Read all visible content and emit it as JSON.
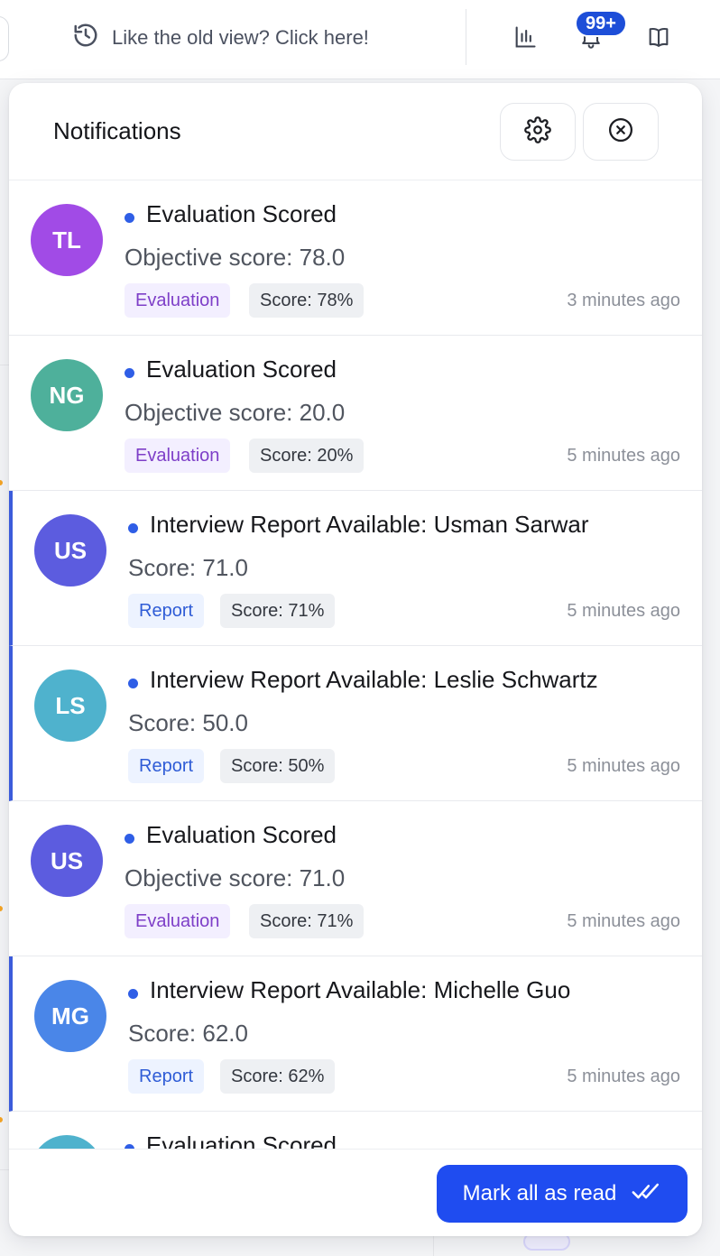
{
  "topbar": {
    "old_view_label": "Like the old view? Click here!",
    "notification_badge": "99+",
    "icons": [
      "history-icon",
      "bar-chart-icon",
      "bell-icon",
      "book-icon"
    ]
  },
  "panel": {
    "title": "Notifications",
    "settings_icon": "gear-icon",
    "close_icon": "close-circle-icon",
    "mark_all_label": "Mark all as read",
    "mark_all_icon": "double-check-icon"
  },
  "colors": {
    "primary": "#1f4cf0",
    "accent_border": "#3b5bdb",
    "unread_dot": "#2f5ee6"
  },
  "notifications": [
    {
      "initials": "TL",
      "avatar_color": "#a14be6",
      "title": "Evaluation Scored",
      "subtitle": "Objective score: 78.0",
      "tag": "Evaluation",
      "score": "Score: 78%",
      "time": "3 minutes ago",
      "accent": false
    },
    {
      "initials": "NG",
      "avatar_color": "#4eb09b",
      "title": "Evaluation Scored",
      "subtitle": "Objective score: 20.0",
      "tag": "Evaluation",
      "score": "Score: 20%",
      "time": "5 minutes ago",
      "accent": false
    },
    {
      "initials": "US",
      "avatar_color": "#5c5cdf",
      "title": "Interview Report Available: Usman Sarwar",
      "subtitle": "Score: 71.0",
      "tag": "Report",
      "score": "Score: 71%",
      "time": "5 minutes ago",
      "accent": true
    },
    {
      "initials": "LS",
      "avatar_color": "#4fb2cd",
      "title": "Interview Report Available: Leslie Schwartz",
      "subtitle": "Score: 50.0",
      "tag": "Report",
      "score": "Score: 50%",
      "time": "5 minutes ago",
      "accent": true
    },
    {
      "initials": "US",
      "avatar_color": "#5c5cdf",
      "title": "Evaluation Scored",
      "subtitle": "Objective score: 71.0",
      "tag": "Evaluation",
      "score": "Score: 71%",
      "time": "5 minutes ago",
      "accent": false
    },
    {
      "initials": "MG",
      "avatar_color": "#4a86e8",
      "title": "Interview Report Available: Michelle Guo",
      "subtitle": "Score: 62.0",
      "tag": "Report",
      "score": "Score: 62%",
      "time": "5 minutes ago",
      "accent": true
    },
    {
      "initials": "",
      "avatar_color": "#4fb2cd",
      "title": "Evaluation Scored",
      "subtitle": "",
      "tag": "",
      "score": "",
      "time": "",
      "accent": false
    }
  ]
}
